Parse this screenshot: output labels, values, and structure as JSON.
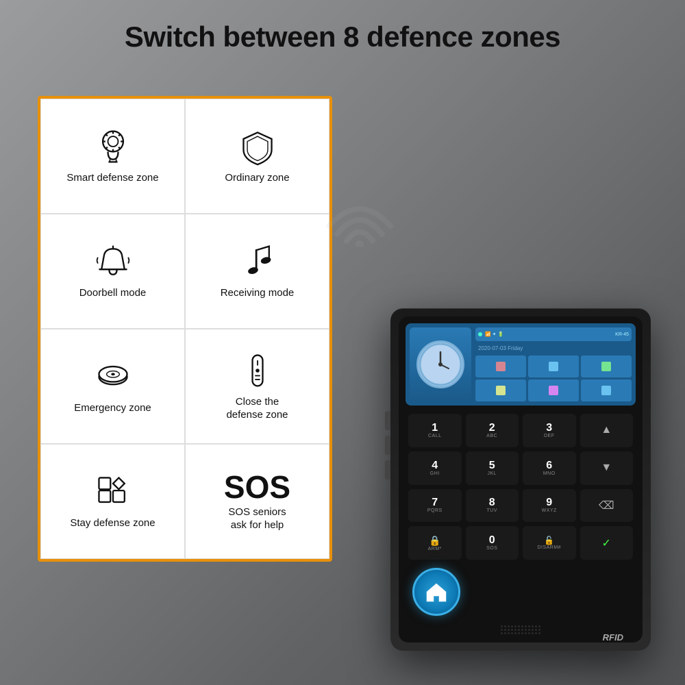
{
  "page": {
    "title": "Switch between 8 defence zones",
    "background_note": "product feature page"
  },
  "info_card": {
    "border_color": "#e8900a",
    "cells": [
      {
        "id": "smart-defense",
        "icon_type": "svg_brain_gear",
        "label": "Smart defense zone"
      },
      {
        "id": "ordinary-zone",
        "icon_type": "svg_shield",
        "label": "Ordinary zone"
      },
      {
        "id": "doorbell-mode",
        "icon_type": "svg_bell",
        "label": "Doorbell mode"
      },
      {
        "id": "receiving-mode",
        "icon_type": "svg_music_note",
        "label": "Receiving mode"
      },
      {
        "id": "emergency-zone",
        "icon_type": "svg_smoke",
        "label": "Emergency zone"
      },
      {
        "id": "close-defense",
        "icon_type": "svg_remote",
        "label": "Close the defense zone"
      },
      {
        "id": "stay-defense",
        "icon_type": "svg_apps",
        "label": "Stay defense zone"
      },
      {
        "id": "sos-seniors",
        "icon_type": "sos_text",
        "label": "SOS seniors ask for help"
      }
    ]
  },
  "keypad": {
    "keys": [
      {
        "num": "1",
        "alpha": "CALL"
      },
      {
        "num": "2",
        "alpha": "ABC"
      },
      {
        "num": "3",
        "alpha": "DEF"
      },
      {
        "num": "↑",
        "alpha": ""
      },
      {
        "num": "4",
        "alpha": "GHI"
      },
      {
        "num": "5",
        "alpha": "JKL"
      },
      {
        "num": "6",
        "alpha": "MNO"
      },
      {
        "num": "↓",
        "alpha": ""
      },
      {
        "num": "7",
        "alpha": "PQRS"
      },
      {
        "num": "8",
        "alpha": "TUV"
      },
      {
        "num": "9",
        "alpha": "WXYZ"
      },
      {
        "num": "↩",
        "alpha": ""
      },
      {
        "num": "🔒",
        "alpha": "ARM*"
      },
      {
        "num": "0",
        "alpha": "SOS"
      },
      {
        "num": "🔓",
        "alpha": "DISARM#"
      },
      {
        "num": "✓",
        "alpha": ""
      }
    ]
  },
  "device": {
    "rfid_label": "RFID"
  },
  "screen": {
    "date_text": "2020-07-03  Friday"
  }
}
